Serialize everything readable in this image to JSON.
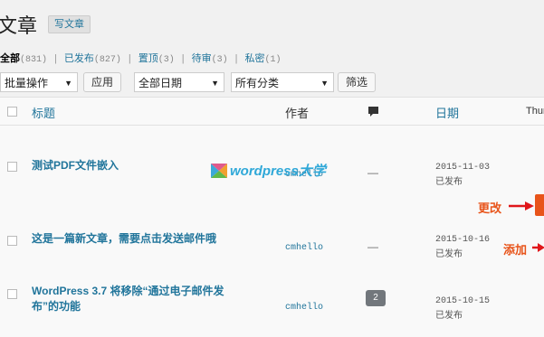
{
  "page": {
    "title": "文章",
    "add_new": "写文章"
  },
  "filters": [
    {
      "label": "全部",
      "count": "(831)"
    },
    {
      "label": "已发布",
      "count": "(827)"
    },
    {
      "label": "置顶",
      "count": "(3)"
    },
    {
      "label": "待审",
      "count": "(3)"
    },
    {
      "label": "私密",
      "count": "(1)"
    }
  ],
  "bulk_actions": {
    "selected": "批量操作",
    "apply": "应用"
  },
  "date_filter": {
    "selected": "全部日期"
  },
  "category_filter": {
    "selected": "所有分类"
  },
  "filter_button": "筛选",
  "columns": {
    "title": "标题",
    "author": "作者",
    "date": "日期",
    "thumb": "Thum"
  },
  "rows": [
    {
      "title": "测试PDF文件嵌入",
      "author": "cmhello",
      "comments": "—",
      "date": "2015-11-03",
      "status": "已发布"
    },
    {
      "title": "这是一篇新文章，需要点击发送邮件哦",
      "author": "cmhello",
      "comments": "—",
      "date": "2015-10-16",
      "status": "已发布"
    },
    {
      "title_line1": "WordPress 3.7 将移除“通过电子邮件发",
      "title_line2": "布”的功能",
      "author": "cmhello",
      "comments": "2",
      "date": "2015-10-15",
      "status": "已发布"
    }
  ],
  "watermark": {
    "text": "wordpress",
    "cn": "大学"
  },
  "annotations": {
    "update": "更改",
    "add": "添加"
  },
  "colors": {
    "link": "#21759b",
    "annotation": "#e8541a",
    "background": "#f1f1f1"
  }
}
